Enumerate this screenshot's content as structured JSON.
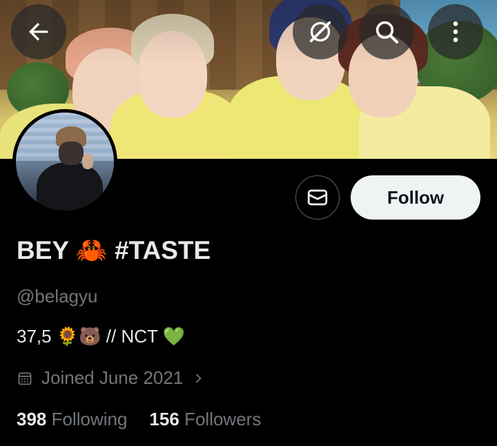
{
  "header": {
    "back_icon": "arrow-left-icon",
    "grok_icon": "grok-icon",
    "search_icon": "search-icon",
    "more_icon": "more-vertical-icon"
  },
  "profile": {
    "display_name": "BEY 🦀 #TASTE",
    "handle": "@belagyu",
    "bio": "37,5 🌻🐻 // NCT 💚",
    "joined": "Joined June 2021"
  },
  "actions": {
    "message_icon": "envelope-icon",
    "follow_label": "Follow"
  },
  "stats": {
    "following_count": "398",
    "following_label": "Following",
    "followers_count": "156",
    "followers_label": "Followers"
  },
  "colors": {
    "background": "#000000",
    "primary_text": "#e7e9ea",
    "secondary_text": "#71767b",
    "follow_button_bg": "#eff3f4"
  }
}
